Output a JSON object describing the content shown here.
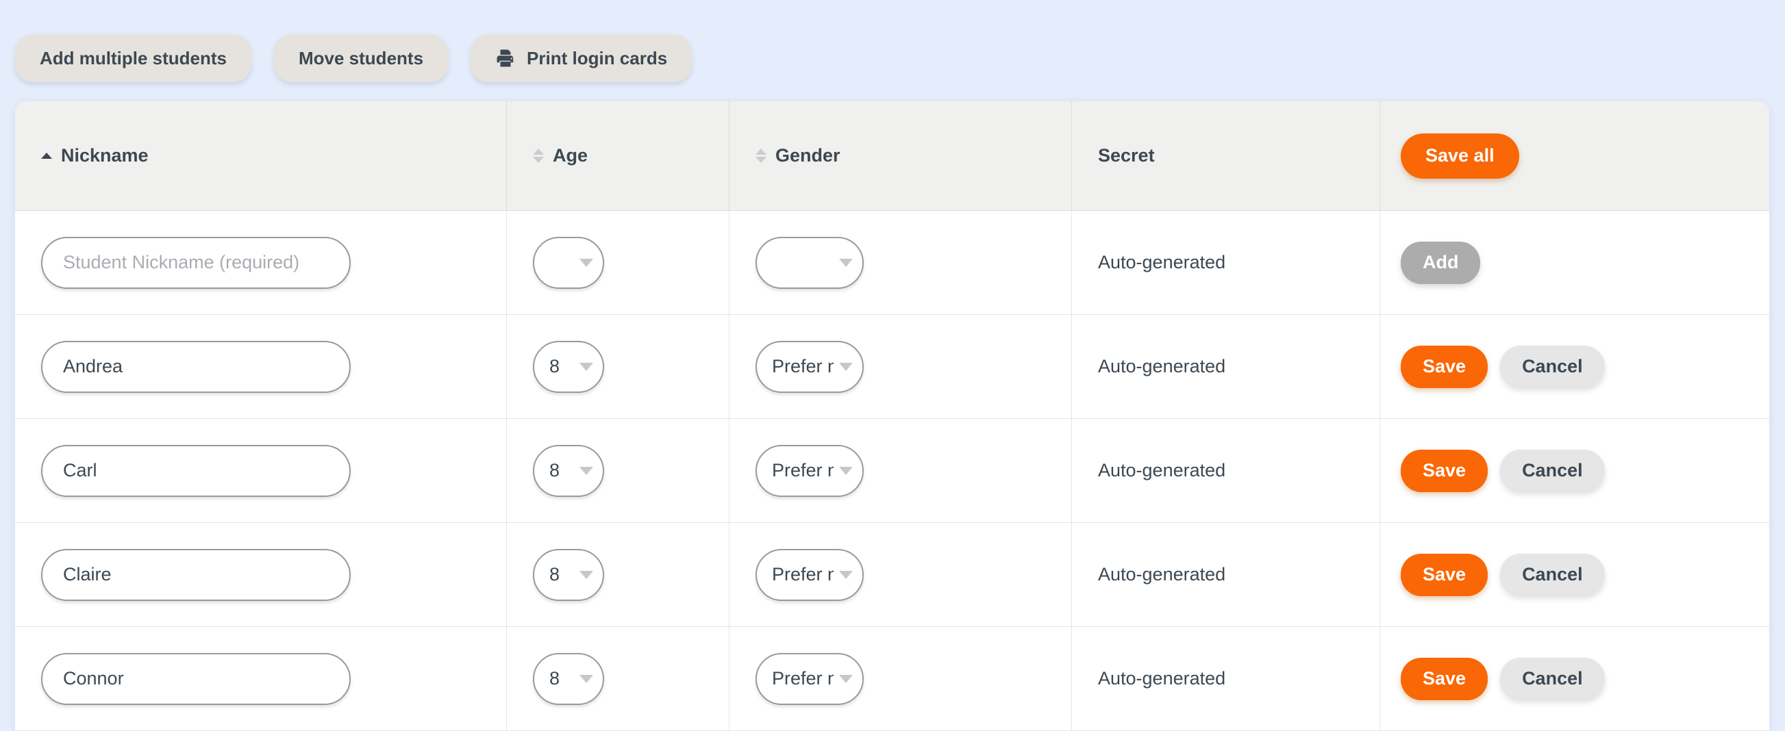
{
  "theme": {
    "page_background": "#e5ecfb",
    "accent": "#f96706",
    "header_background": "#f0f0ef",
    "toolbar_button_background": "#e6e3df",
    "text": "#3d4852",
    "disabled": "#acacac"
  },
  "toolbar": {
    "buttons": [
      {
        "label": "Add multiple students",
        "icon": null
      },
      {
        "label": "Move students",
        "icon": null
      },
      {
        "label": "Print login cards",
        "icon": "printer-icon"
      }
    ]
  },
  "table": {
    "columns": [
      {
        "key": "nickname",
        "label": "Nickname",
        "sortable": true,
        "sort": "asc"
      },
      {
        "key": "age",
        "label": "Age",
        "sortable": true,
        "sort": "none"
      },
      {
        "key": "gender",
        "label": "Gender",
        "sortable": true,
        "sort": "none"
      },
      {
        "key": "secret",
        "label": "Secret",
        "sortable": false,
        "sort": null
      },
      {
        "key": "actions",
        "label": "",
        "sortable": false,
        "sort": null
      }
    ],
    "header_action": {
      "label": "Save all",
      "state": "enabled"
    },
    "new_row": {
      "nickname_value": "",
      "nickname_placeholder": "Student Nickname (required)",
      "age_value": "",
      "gender_value": "",
      "secret": "Auto-generated",
      "add_button": {
        "label": "Add",
        "state": "disabled"
      }
    },
    "rows": [
      {
        "nickname": "Andrea",
        "age": "8",
        "gender": "Prefer no",
        "secret": "Auto-generated",
        "save_label": "Save",
        "cancel_label": "Cancel"
      },
      {
        "nickname": "Carl",
        "age": "8",
        "gender": "Prefer no",
        "secret": "Auto-generated",
        "save_label": "Save",
        "cancel_label": "Cancel"
      },
      {
        "nickname": "Claire",
        "age": "8",
        "gender": "Prefer no",
        "secret": "Auto-generated",
        "save_label": "Save",
        "cancel_label": "Cancel"
      },
      {
        "nickname": "Connor",
        "age": "8",
        "gender": "Prefer no",
        "secret": "Auto-generated",
        "save_label": "Save",
        "cancel_label": "Cancel"
      }
    ]
  }
}
